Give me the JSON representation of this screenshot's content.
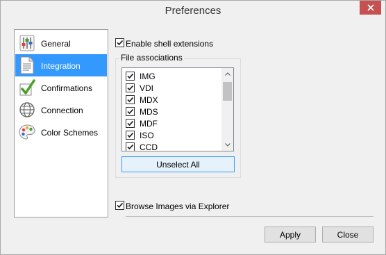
{
  "window": {
    "title": "Preferences",
    "close_glyph": "close-icon"
  },
  "sidebar": {
    "items": [
      {
        "label": "General",
        "icon": "sliders-icon",
        "selected": false
      },
      {
        "label": "Integration",
        "icon": "document-icon",
        "selected": true
      },
      {
        "label": "Confirmations",
        "icon": "checkmark-icon",
        "selected": false
      },
      {
        "label": "Connection",
        "icon": "globe-icon",
        "selected": false
      },
      {
        "label": "Color Schemes",
        "icon": "palette-icon",
        "selected": false
      }
    ]
  },
  "integration": {
    "shell_extensions": {
      "label": "Enable shell extensions",
      "checked": true
    },
    "file_associations": {
      "legend": "File associations",
      "items": [
        {
          "label": "IMG",
          "checked": true
        },
        {
          "label": "VDI",
          "checked": true
        },
        {
          "label": "MDX",
          "checked": true
        },
        {
          "label": "MDS",
          "checked": true
        },
        {
          "label": "MDF",
          "checked": true
        },
        {
          "label": "ISO",
          "checked": true
        },
        {
          "label": "CCD",
          "checked": true
        }
      ],
      "unselect_all_label": "Unselect All"
    },
    "browse_images": {
      "label": "Browse Images via Explorer",
      "checked": true
    }
  },
  "footer": {
    "apply_label": "Apply",
    "close_label": "Close"
  },
  "colors": {
    "selection": "#3399ff",
    "close_button": "#c75050",
    "window_bg": "#f0f0f0"
  }
}
